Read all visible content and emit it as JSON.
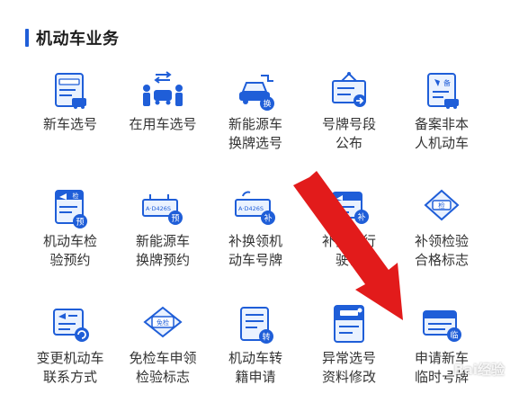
{
  "section": {
    "title": "机动车业务"
  },
  "services": [
    {
      "id": "new-car-plate",
      "label": "新车选号",
      "icon": "new-car-plate-icon"
    },
    {
      "id": "used-car-plate",
      "label": "在用车选号",
      "icon": "people-car-icon"
    },
    {
      "id": "nev-plate-change",
      "label": "新能源车\n换牌选号",
      "icon": "ev-plug-car-icon"
    },
    {
      "id": "plate-segment",
      "label": "号牌号段\n公布",
      "icon": "sign-board-icon"
    },
    {
      "id": "register-non-owner",
      "label": "备案非本\n人机动车",
      "icon": "registration-doc-icon"
    },
    {
      "id": "inspection-booking",
      "label": "机动车检\n验预约",
      "icon": "inspection-doc-icon"
    },
    {
      "id": "nev-plate-booking",
      "label": "新能源车\n换牌预约",
      "icon": "plate-booking-icon"
    },
    {
      "id": "replace-plate",
      "label": "补换领机\n动车号牌",
      "icon": "plate-replace-icon"
    },
    {
      "id": "replace-license",
      "label": "补换领行\n驶证",
      "icon": "license-replace-icon"
    },
    {
      "id": "replace-inspection-mark",
      "label": "补领检验\n合格标志",
      "icon": "inspection-mark-icon"
    },
    {
      "id": "change-contact",
      "label": "变更机动车\n联系方式",
      "icon": "contact-change-icon"
    },
    {
      "id": "exempt-mark",
      "label": "免检车申领\n检验标志",
      "icon": "exempt-mark-icon"
    },
    {
      "id": "transfer",
      "label": "机动车转\n籍申请",
      "icon": "transfer-doc-icon"
    },
    {
      "id": "abnormal-edit",
      "label": "异常选号\n资料修改",
      "icon": "abnormal-edit-icon"
    },
    {
      "id": "temp-plate",
      "label": "申请新车\n临时号牌",
      "icon": "temp-plate-icon"
    }
  ],
  "icon_text": {
    "plate_number": "A·D426S",
    "inspect": "检",
    "booking": "预",
    "swap": "换",
    "replace": "补",
    "transfer": "转",
    "temp": "临",
    "exempt": "免检",
    "record": "备"
  },
  "watermark": {
    "text": "Bai经验"
  },
  "colors": {
    "primary": "#1f5ed8",
    "light_fill": "#eaf2ff",
    "annotation_arrow": "#e21b1b"
  }
}
